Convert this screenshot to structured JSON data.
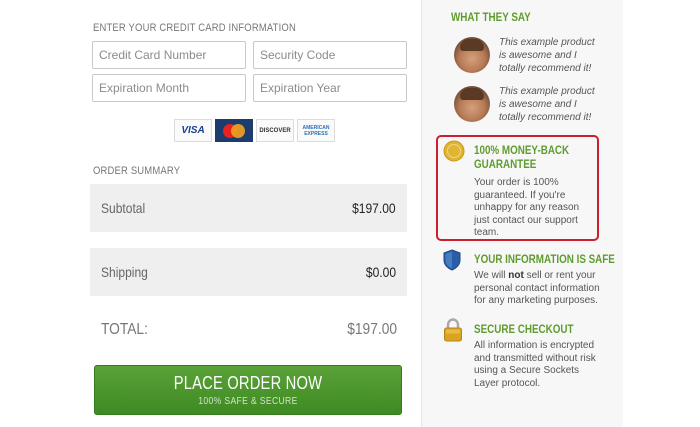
{
  "credit_card": {
    "heading": "ENTER YOUR CREDIT CARD INFORMATION",
    "card_number_placeholder": "Credit Card Number",
    "security_code_placeholder": "Security Code",
    "exp_month_placeholder": "Expiration Month",
    "exp_year_placeholder": "Expiration Year",
    "card_logos": {
      "visa": "VISA",
      "discover": "DISCOVER",
      "amex_line1": "AMERICAN",
      "amex_line2": "EXPRESS"
    }
  },
  "order_summary": {
    "heading": "ORDER SUMMARY",
    "subtotal_label": "Subtotal",
    "subtotal_value": "$197.00",
    "shipping_label": "Shipping",
    "shipping_value": "$0.00",
    "total_label": "TOTAL:",
    "total_value": "$197.00"
  },
  "place_order": {
    "label": "PLACE ORDER NOW",
    "sublabel": "100% SAFE & SECURE"
  },
  "sidebar": {
    "testimonials_heading": "WHAT THEY SAY",
    "testimonials": [
      {
        "text": "This example product is awesome and I totally recommend it!"
      },
      {
        "text": "This example product is awesome and I totally recommend it!"
      }
    ],
    "guarantee": {
      "title": "100% MONEY-BACK GUARANTEE",
      "text": "Your order is 100% guaranteed. If you're unhappy for any reason just contact our support team."
    },
    "info_safe": {
      "title": "YOUR INFORMATION IS SAFE",
      "text_before": "We will ",
      "text_bold": "not",
      "text_after": " sell or rent your personal contact information for any marketing purposes."
    },
    "secure_checkout": {
      "title": "SECURE CHECKOUT",
      "text": "All information is encrypted and transmitted without risk using a Secure Sockets Layer protocol."
    }
  },
  "colors": {
    "accent_green": "#5f9c2f",
    "button_green": "#4a9a2c",
    "highlight_red": "#cc1f2d",
    "shield_blue": "#2a5fa8",
    "lock_gold": "#d9a421"
  }
}
